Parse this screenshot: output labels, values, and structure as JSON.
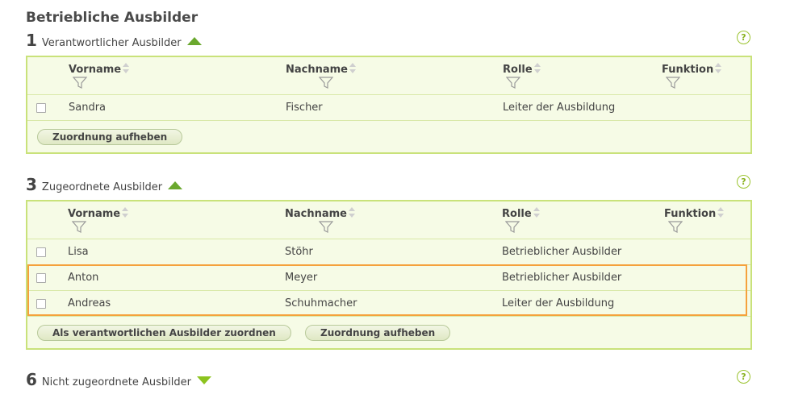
{
  "page": {
    "title": "Betriebliche Ausbilder"
  },
  "colors": {
    "border": "#c9e27a",
    "background": "#f6fbe6",
    "highlight": "#f5a13c",
    "accent_green": "#6aa82e"
  },
  "sections": [
    {
      "number": "1",
      "label": "Verantwortlicher Ausbilder",
      "expanded": true,
      "columns": [
        "Vorname",
        "Nachname",
        "Rolle",
        "Funktion"
      ],
      "rows": [
        {
          "vorname": "Sandra",
          "nachname": "Fischer",
          "rolle": "Leiter der Ausbildung",
          "funktion": ""
        }
      ],
      "buttons": [
        "Zuordnung aufheben"
      ]
    },
    {
      "number": "3",
      "label": "Zugeordnete Ausbilder",
      "expanded": true,
      "columns": [
        "Vorname",
        "Nachname",
        "Rolle",
        "Funktion"
      ],
      "rows": [
        {
          "vorname": "Lisa",
          "nachname": "Stöhr",
          "rolle": "Betrieblicher Ausbilder",
          "funktion": ""
        },
        {
          "vorname": "Anton",
          "nachname": "Meyer",
          "rolle": "Betrieblicher Ausbilder",
          "funktion": ""
        },
        {
          "vorname": "Andreas",
          "nachname": "Schuhmacher",
          "rolle": "Leiter der Ausbildung",
          "funktion": ""
        }
      ],
      "buttons": [
        "Als verantwortlichen Ausbilder zuordnen",
        "Zuordnung aufheben"
      ]
    },
    {
      "number": "6",
      "label": "Nicht zugeordnete Ausbilder",
      "expanded": false
    }
  ],
  "icons": {
    "help": "help-circle-icon",
    "expanded": "triangle-up-icon",
    "collapsed": "triangle-down-icon",
    "sort": "sort-arrows-icon",
    "filter": "funnel-filter-icon"
  },
  "help_glyph": "?"
}
